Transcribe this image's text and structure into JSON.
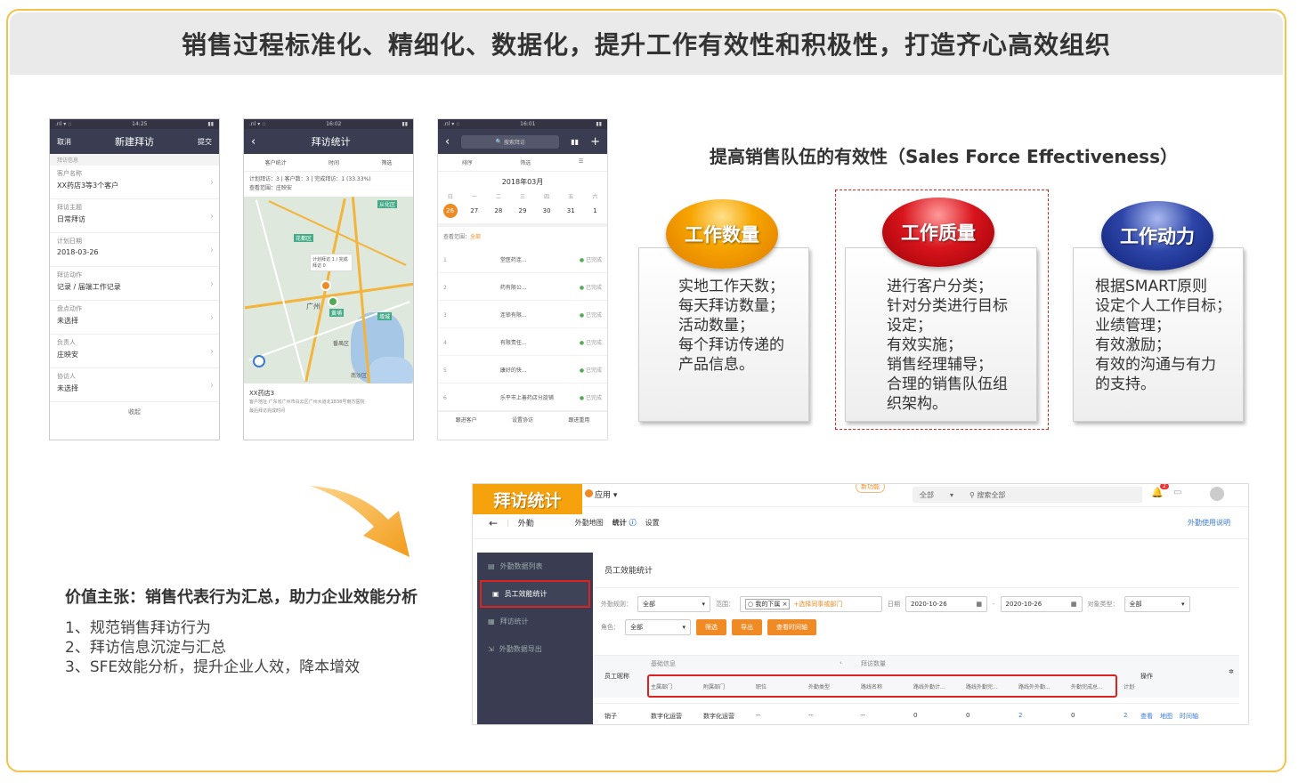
{
  "title": "销售过程标准化、精细化、数据化，提升工作有效性和积极性，打造齐心高效组织",
  "phone1": {
    "time": "14:25",
    "left": "取消",
    "title": "新建拜访",
    "right": "提交",
    "section": "拜访信息",
    "rows": [
      {
        "label": "客户名称",
        "value": "XX药店3等3个客户"
      },
      {
        "label": "拜访主题",
        "value": "日常拜访"
      },
      {
        "label": "计划日期",
        "value": "2018-03-26"
      },
      {
        "label": "拜访动作",
        "value": "记录 / 届端工作记录"
      },
      {
        "label": "盘点动作",
        "value": "未选择"
      },
      {
        "label": "负责人",
        "value": "庄映安"
      },
      {
        "label": "协访人",
        "value": "未选择"
      }
    ],
    "footer": "收起"
  },
  "phone2": {
    "time": "16:02",
    "title": "拜访统计",
    "tabs": [
      "客户统计",
      "时间",
      "筛选"
    ],
    "stat": "计划拜访：3 | 客户数：3 | 完成拜访：1 (33.33%)",
    "scope": "查看范围：庄映安",
    "map_labels": [
      "从化区",
      "花都区",
      "广州",
      "增城",
      "黄埔",
      "番禺区",
      "南沙区"
    ],
    "popup": "计划拜访 1 / 完成拜访 0",
    "place": "XX药店3",
    "addr": "客户地址 广东省广州市白云区广州大道北1838号南方医院",
    "last": "最后拜访完成时间"
  },
  "phone3": {
    "time": "16:01",
    "search": "搜索拜访",
    "sort": "排序",
    "filter": "筛选",
    "month": "2018年03月",
    "weekdays": [
      "日",
      "一",
      "二",
      "三",
      "四",
      "五",
      "六"
    ],
    "days": [
      "26",
      "27",
      "28",
      "29",
      "30",
      "31",
      "1"
    ],
    "scope_label": "查看范围：",
    "scope": "全部",
    "items": [
      {
        "n": "1",
        "name": "堂医药连...",
        "s": "已完成"
      },
      {
        "n": "2",
        "name": "药有限公...",
        "s": "已完成"
      },
      {
        "n": "3",
        "name": "连锁有限...",
        "s": "已完成"
      },
      {
        "n": "4",
        "name": "有限责任...",
        "s": "已完成"
      },
      {
        "n": "5",
        "name": "康好的快...",
        "s": "已完成"
      },
      {
        "n": "6",
        "name": "乐平市上善药店分旋铺",
        "s": "已完成"
      }
    ],
    "bottom": [
      "跟进客户",
      "设置协访",
      "跟进重用"
    ]
  },
  "sfe": {
    "title": "提高销售队伍的有效性（Sales Force Effectiveness）",
    "cards": [
      {
        "orb": "工作数量",
        "lines": [
          "实地工作天数；",
          "每天拜访数量；",
          "活动数量；",
          "每个拜访传递的",
          "产品信息。"
        ]
      },
      {
        "orb": "工作质量",
        "lines": [
          "进行客户分类；",
          "针对分类进行目标",
          "设定；",
          "有效实施；",
          "销售经理辅导；",
          "合理的销售队伍组",
          "织架构。"
        ]
      },
      {
        "orb": "工作动力",
        "lines": [
          "根据SMART原则",
          "设定个人工作目标；",
          "业绩管理；",
          "有效激励；",
          "有效的沟通与有力",
          "的支持。"
        ]
      }
    ]
  },
  "value": {
    "title": "价值主张：销售代表行为汇总，助力企业效能分析",
    "items": [
      "1、规范销售拜访行为",
      "2、拜访信息沉淀与汇总",
      "3、SFE效能分析，提升企业人效，降本增效"
    ]
  },
  "app": {
    "badge": "拜访统计",
    "apps": "应用",
    "pill": "新功能",
    "scope": "全部",
    "search": "搜索全部",
    "notif": "2",
    "module": "外勤",
    "tabs": [
      "外勤地图",
      "统计",
      "设置"
    ],
    "help": "外勤使用说明",
    "side": [
      "外勤数据列表",
      "员工效能统计",
      "拜访统计",
      "外勤数据导出"
    ],
    "panel_title": "员工效能统计",
    "filters": {
      "rule_label": "外勤规则：",
      "rule": "全部",
      "range_label": "范围：",
      "range_tag": "我的下属",
      "range_add": "+选择同事或部门",
      "date_label": "日期",
      "date_from": "2020-10-26",
      "date_to": "2020-10-26",
      "obj_label": "对象类型：",
      "obj": "全部",
      "role_label": "角色：",
      "role": "全部"
    },
    "buttons": [
      "筛选",
      "导出",
      "查看时间轴"
    ],
    "groups": [
      "基础信息",
      "拜访数量"
    ],
    "col_name": "员工昵称",
    "col_op": "操作",
    "cols": [
      "主属部门",
      "附属部门",
      "职位",
      "外勤类型",
      "路线名称",
      "路线外勤计...",
      "路线外勤完...",
      "路线外外勤...",
      "外勤完成总...",
      "计划"
    ],
    "row": {
      "name": "销子",
      "cells": [
        "数字化运营",
        "数字化运营",
        "--",
        "--",
        "--",
        "0",
        "0",
        "2",
        "0",
        "2"
      ],
      "ops": [
        "查看",
        "地图",
        "时间轴"
      ]
    }
  }
}
